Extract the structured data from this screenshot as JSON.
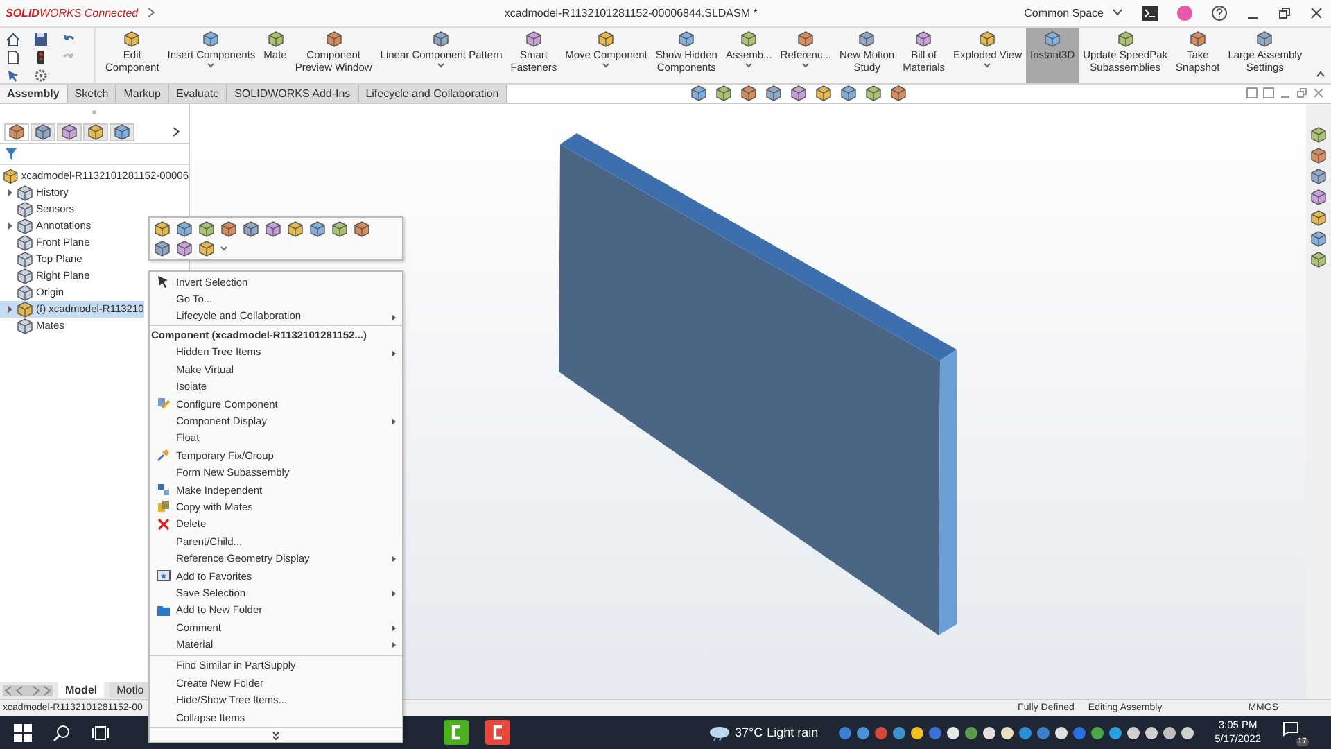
{
  "window": {
    "app_name": "**SOLID**WORKS Connected",
    "title": "xcadmodel-R1132101281152-00006844.SLDASM *",
    "workspace": "Common Space"
  },
  "commands": [
    {
      "label": "Edit\nComponent",
      "dropdown": false,
      "selected": false
    },
    {
      "label": "Insert Components",
      "dropdown": true,
      "selected": false
    },
    {
      "label": "Mate",
      "dropdown": false,
      "selected": false
    },
    {
      "label": "Component\nPreview Window",
      "dropdown": false,
      "selected": false
    },
    {
      "label": "Linear Component Pattern",
      "dropdown": true,
      "selected": false
    },
    {
      "label": "Smart\nFasteners",
      "dropdown": false,
      "selected": false
    },
    {
      "label": "Move Component",
      "dropdown": true,
      "selected": false
    },
    {
      "label": "Show Hidden\nComponents",
      "dropdown": false,
      "selected": false
    },
    {
      "label": "Assemb...",
      "dropdown": true,
      "selected": false
    },
    {
      "label": "Referenc...",
      "dropdown": true,
      "selected": false
    },
    {
      "label": "New Motion\nStudy",
      "dropdown": false,
      "selected": false
    },
    {
      "label": "Bill of\nMaterials",
      "dropdown": false,
      "selected": false
    },
    {
      "label": "Exploded View",
      "dropdown": true,
      "selected": false
    },
    {
      "label": "Instant3D",
      "dropdown": false,
      "selected": true
    },
    {
      "label": "Update SpeedPak\nSubassemblies",
      "dropdown": false,
      "selected": false
    },
    {
      "label": "Take\nSnapshot",
      "dropdown": false,
      "selected": false
    },
    {
      "label": "Large Assembly\nSettings",
      "dropdown": false,
      "selected": false
    }
  ],
  "tabs": [
    {
      "label": "Assembly",
      "selected": true
    },
    {
      "label": "Sketch",
      "selected": false
    },
    {
      "label": "Markup",
      "selected": false
    },
    {
      "label": "Evaluate",
      "selected": false
    },
    {
      "label": "SOLIDWORKS Add-Ins",
      "selected": false
    },
    {
      "label": "Lifecycle and Collaboration",
      "selected": false
    }
  ],
  "panel_tabs": [
    {
      "selected": true
    },
    {
      "selected": false
    },
    {
      "selected": false
    },
    {
      "selected": false
    },
    {
      "selected": false
    }
  ],
  "tree": {
    "label": "xcadmodel-R1132101281152-00006",
    "children": [
      {
        "label": "History",
        "expander": true,
        "selected": false
      },
      {
        "label": "Sensors",
        "expander": false,
        "selected": false
      },
      {
        "label": "Annotations",
        "expander": true,
        "selected": false
      },
      {
        "label": "Front Plane",
        "expander": false,
        "selected": false
      },
      {
        "label": "Top Plane",
        "expander": false,
        "selected": false
      },
      {
        "label": "Right Plane",
        "expander": false,
        "selected": false
      },
      {
        "label": "Origin",
        "expander": false,
        "selected": false
      },
      {
        "label": "(f) xcadmodel-R113210",
        "expander": true,
        "selected": true
      },
      {
        "label": "Mates",
        "expander": false,
        "selected": false
      }
    ]
  },
  "bottom_tabs": [
    {
      "label": "Model",
      "selected": true
    },
    {
      "label": "Motio",
      "selected": false
    }
  ],
  "context_menu": {
    "more": true,
    "items": [
      {
        "kind": "item",
        "label": "Invert Selection",
        "submenu": false
      },
      {
        "kind": "item",
        "label": "Go To...",
        "submenu": false
      },
      {
        "kind": "item",
        "label": "Lifecycle and Collaboration",
        "submenu": true
      },
      {
        "kind": "header",
        "label": "Component (xcadmodel-R1132101281152...)"
      },
      {
        "kind": "item",
        "label": "Hidden Tree Items",
        "submenu": true
      },
      {
        "kind": "item",
        "label": "Make Virtual",
        "submenu": false
      },
      {
        "kind": "item",
        "label": "Isolate",
        "submenu": false
      },
      {
        "kind": "item",
        "label": "Configure Component",
        "submenu": false
      },
      {
        "kind": "item",
        "label": "Component Display",
        "submenu": true
      },
      {
        "kind": "item",
        "label": "Float",
        "submenu": false
      },
      {
        "kind": "item",
        "label": "Temporary Fix/Group",
        "submenu": false
      },
      {
        "kind": "item",
        "label": "Form New Subassembly",
        "submenu": false
      },
      {
        "kind": "item",
        "label": "Make Independent",
        "submenu": false
      },
      {
        "kind": "item",
        "label": "Copy with Mates",
        "submenu": false
      },
      {
        "kind": "item",
        "label": "Delete",
        "submenu": false
      },
      {
        "kind": "item",
        "label": "Parent/Child...",
        "submenu": false
      },
      {
        "kind": "item",
        "label": "Reference Geometry Display",
        "submenu": true
      },
      {
        "kind": "item",
        "label": "Add to Favorites",
        "submenu": false
      },
      {
        "kind": "item",
        "label": "Save Selection",
        "submenu": true
      },
      {
        "kind": "item",
        "label": "Add to New Folder",
        "submenu": false
      },
      {
        "kind": "item",
        "label": "Comment",
        "submenu": true
      },
      {
        "kind": "item",
        "label": "Material",
        "submenu": true
      },
      {
        "kind": "separator"
      },
      {
        "kind": "item",
        "label": "Find Similar in PartSupply",
        "submenu": false
      },
      {
        "kind": "item",
        "label": "Create New Folder",
        "submenu": false
      },
      {
        "kind": "item",
        "label": "Hide/Show Tree Items...",
        "submenu": false
      },
      {
        "kind": "item",
        "label": "Collapse Items",
        "submenu": false
      },
      {
        "kind": "separator"
      }
    ]
  },
  "status_bar": {
    "document": "xcadmodel-R1132101281152-00",
    "items": [
      "Fully Defined",
      "Editing Assembly"
    ],
    "units": "MMGS"
  },
  "taskbar": {
    "temperature": "37°C",
    "condition": "Light rain",
    "time": "3:05 PM",
    "date": "5/17/2022",
    "notification_count": "17"
  }
}
